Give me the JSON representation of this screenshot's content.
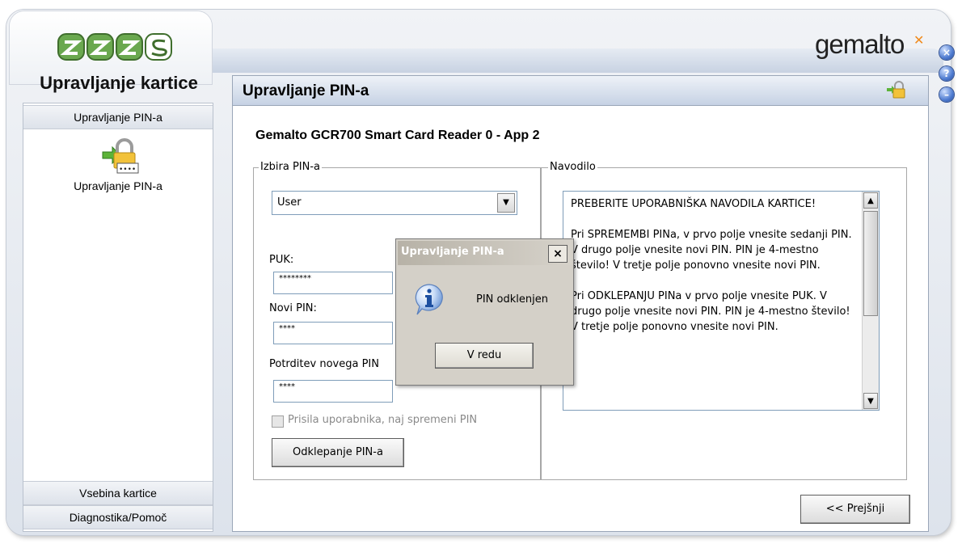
{
  "app": {
    "title": "Upravljanje kartice",
    "brand": "gemalto",
    "logo_text": "ZZZS",
    "window_buttons": [
      "close",
      "help",
      "minimize"
    ]
  },
  "sidebar": {
    "header_top": "Upravljanje PIN-a",
    "item_label": "Upravljanje PIN-a",
    "item_icon": "pin-lock-icon",
    "header_content": "Vsebina kartice",
    "header_diag": "Diagnostika/Pomoč"
  },
  "main": {
    "title": "Upravljanje PIN-a",
    "reader": "Gemalto GCR700 Smart Card Reader 0 - App 2",
    "select_group": {
      "legend": "Izbira PIN-a",
      "pin_type": "User",
      "puk_label": "PUK:",
      "puk_value": "********",
      "new_pin_label": "Novi PIN:",
      "new_pin_value": "****",
      "confirm_label": "Potrditev novega PIN",
      "confirm_value": "****",
      "force_label": "Prisila uporabnika, naj spremeni PIN",
      "unlock_button": "Odklepanje PIN-a"
    },
    "help_group": {
      "legend": "Navodilo",
      "lines": [
        "PREBERITE UPORABNIŠKA NAVODILA KARTICE!",
        "Pri SPREMEMBI PINa, v prvo polje vnesite sedanji PIN. V drugo polje vnesite novi PIN. PIN je 4-mestno število! V tretje polje ponovno vnesite novi PIN.",
        "Pri ODKLEPANJU PINa v prvo polje vnesite PUK. V drugo polje vnesite novi PIN. PIN je 4-mestno število! V tretje polje ponovno vnesite novi PIN."
      ]
    },
    "prev_button": "<< Prejšnji"
  },
  "modal": {
    "title": "Upravljanje PIN-a",
    "close": "×",
    "message": "PIN odklenjen",
    "ok": "V redu",
    "icon": "info-icon"
  },
  "colors": {
    "accent": "#4e7bd0",
    "panel": "#d4d0c8",
    "brand_orange": "#f08a1c"
  }
}
